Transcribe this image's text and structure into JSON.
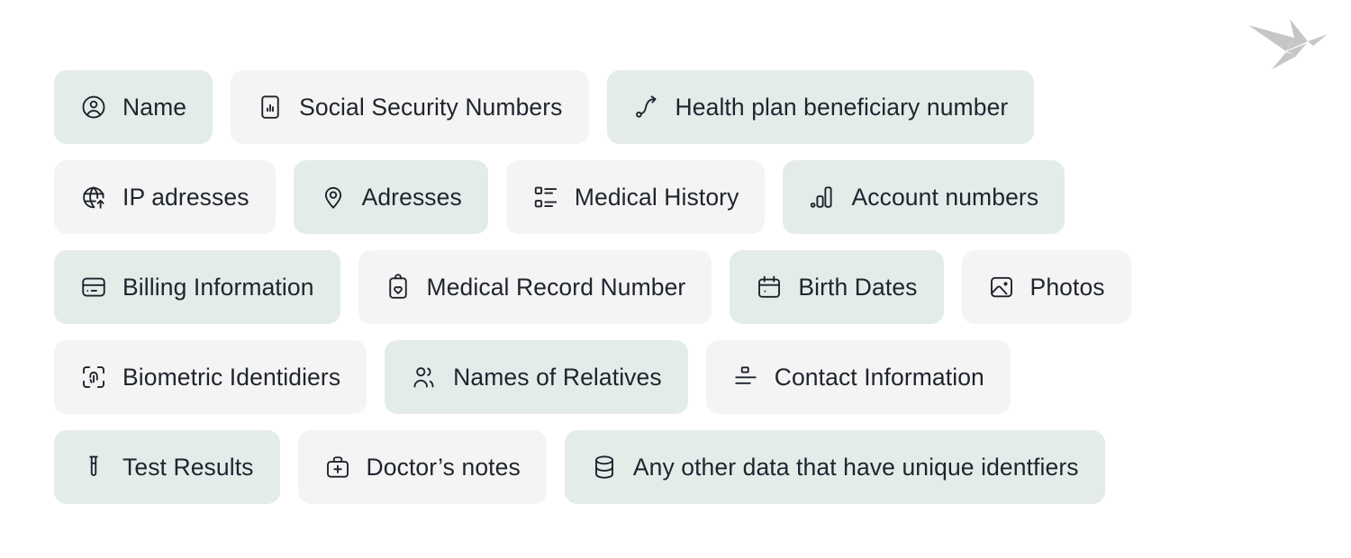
{
  "logo": {
    "name": "origami-bird-logo",
    "color": "#c6c6c6"
  },
  "theme": {
    "background": "#ffffff",
    "chip_tint_background": "#e4ecea",
    "chip_plain_background": "#f4f4f4",
    "text_color": "#1f242d",
    "icon_color": "#1d222b"
  },
  "rows": [
    {
      "chips": [
        {
          "label": "Name",
          "icon": "user-circle-icon",
          "style": "tint"
        },
        {
          "label": "Social Security Numbers",
          "icon": "id-document-chart-icon",
          "style": "plain"
        },
        {
          "label": "Health plan beneficiary number",
          "icon": "curved-arrow-icon",
          "style": "tint"
        }
      ]
    },
    {
      "chips": [
        {
          "label": "IP adresses",
          "icon": "globe-arrow-icon",
          "style": "plain"
        },
        {
          "label": "Adresses",
          "icon": "map-pin-icon",
          "style": "tint"
        },
        {
          "label": "Medical History",
          "icon": "checklist-icon",
          "style": "plain"
        },
        {
          "label": "Account numbers",
          "icon": "bar-chart-ascending-icon",
          "style": "tint"
        }
      ]
    },
    {
      "chips": [
        {
          "label": "Billing Information",
          "icon": "credit-card-icon",
          "style": "tint"
        },
        {
          "label": "Medical Record Number",
          "icon": "clipboard-heart-icon",
          "style": "plain"
        },
        {
          "label": "Birth Dates",
          "icon": "calendar-icon",
          "style": "tint"
        },
        {
          "label": "Photos",
          "icon": "image-icon",
          "style": "plain"
        }
      ]
    },
    {
      "chips": [
        {
          "label": "Biometric Identidiers",
          "icon": "fingerprint-scan-icon",
          "style": "plain"
        },
        {
          "label": "Names of Relatives",
          "icon": "users-icon",
          "style": "tint"
        },
        {
          "label": "Contact Information",
          "icon": "contact-card-icon",
          "style": "plain"
        }
      ]
    },
    {
      "chips": [
        {
          "label": "Test Results",
          "icon": "test-tube-icon",
          "style": "tint"
        },
        {
          "label": "Doctor’s notes",
          "icon": "medical-bag-icon",
          "style": "plain"
        },
        {
          "label": "Any other data that have unique identfiers",
          "icon": "database-icon",
          "style": "tint"
        }
      ]
    }
  ]
}
